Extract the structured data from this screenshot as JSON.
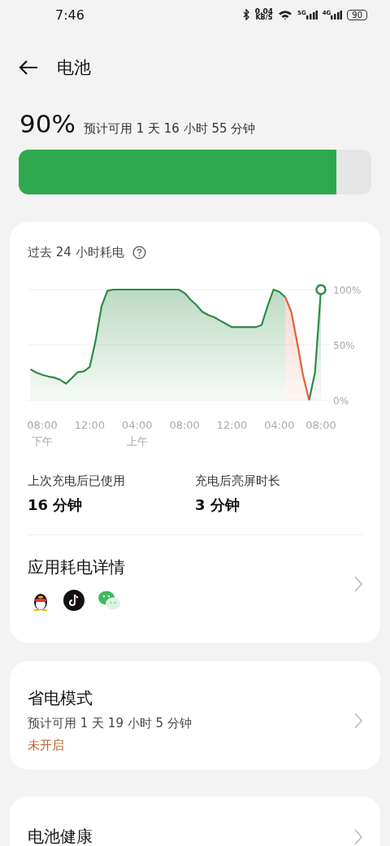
{
  "status_bar": {
    "time": "7:46",
    "net_speed": "0.04",
    "net_unit": "KB/S",
    "signals": [
      {
        "label": "5G"
      },
      {
        "label": "4G"
      }
    ],
    "battery": "90"
  },
  "header": {
    "title": "电池"
  },
  "battery": {
    "percent": "90%",
    "estimate": "预计可用 1 天 16 小时 55 分钟",
    "level": 0.9
  },
  "usage_card": {
    "title": "过去 24 小时耗电",
    "chart_data": {
      "type": "area",
      "categories": [
        null,
        null,
        "08:00",
        null,
        null,
        null,
        null,
        null,
        null,
        null,
        "12:00",
        null,
        null,
        null,
        null,
        null,
        null,
        null,
        "04:00",
        null,
        null,
        null,
        null,
        null,
        null,
        null,
        "08:00",
        null,
        null,
        null,
        null,
        null,
        null,
        null,
        "12:00",
        null,
        null,
        null,
        null,
        null,
        null,
        null,
        "04:00",
        null,
        null,
        null,
        null,
        null,
        null,
        "08:00"
      ],
      "series": [
        {
          "color": "#2e8b47",
          "values": [
            28,
            25,
            23,
            21.5,
            20.5,
            18.5,
            15,
            20,
            25.5,
            26,
            30,
            54,
            85,
            99,
            100,
            100,
            100,
            100,
            100,
            100,
            100,
            100,
            100,
            100,
            100,
            100,
            97,
            91,
            86,
            80,
            77,
            75,
            72,
            69,
            66,
            66,
            66,
            66,
            66,
            68,
            85,
            100,
            98,
            93,
            null,
            null,
            null,
            0,
            25,
            100
          ]
        },
        {
          "color": "#e0603a",
          "values": [
            null,
            null,
            null,
            null,
            null,
            null,
            null,
            null,
            null,
            null,
            null,
            null,
            null,
            null,
            null,
            null,
            null,
            null,
            null,
            null,
            null,
            null,
            null,
            null,
            null,
            null,
            null,
            null,
            null,
            null,
            null,
            null,
            null,
            null,
            null,
            null,
            null,
            null,
            null,
            null,
            null,
            null,
            null,
            93,
            80,
            52,
            22,
            0,
            null,
            null
          ]
        }
      ],
      "ylim": [
        0,
        100
      ],
      "yticks": [
        {
          "value": 0,
          "label": "0%"
        },
        {
          "value": 50,
          "label": "50%"
        },
        {
          "value": 100,
          "label": "100%"
        }
      ],
      "annotations": [
        "下午",
        "上午"
      ]
    },
    "stats": [
      {
        "label": "上次充电后已使用",
        "value": "16 分钟"
      },
      {
        "label": "充电后亮屏时长",
        "value": "3 分钟"
      }
    ],
    "apps_title": "应用耗电详情"
  },
  "power_saving": {
    "title": "省电模式",
    "subtitle": "预计可用 1 天 19 小时 5 分钟",
    "status": "未开启",
    "on": false
  },
  "health": {
    "title": "电池健康"
  }
}
